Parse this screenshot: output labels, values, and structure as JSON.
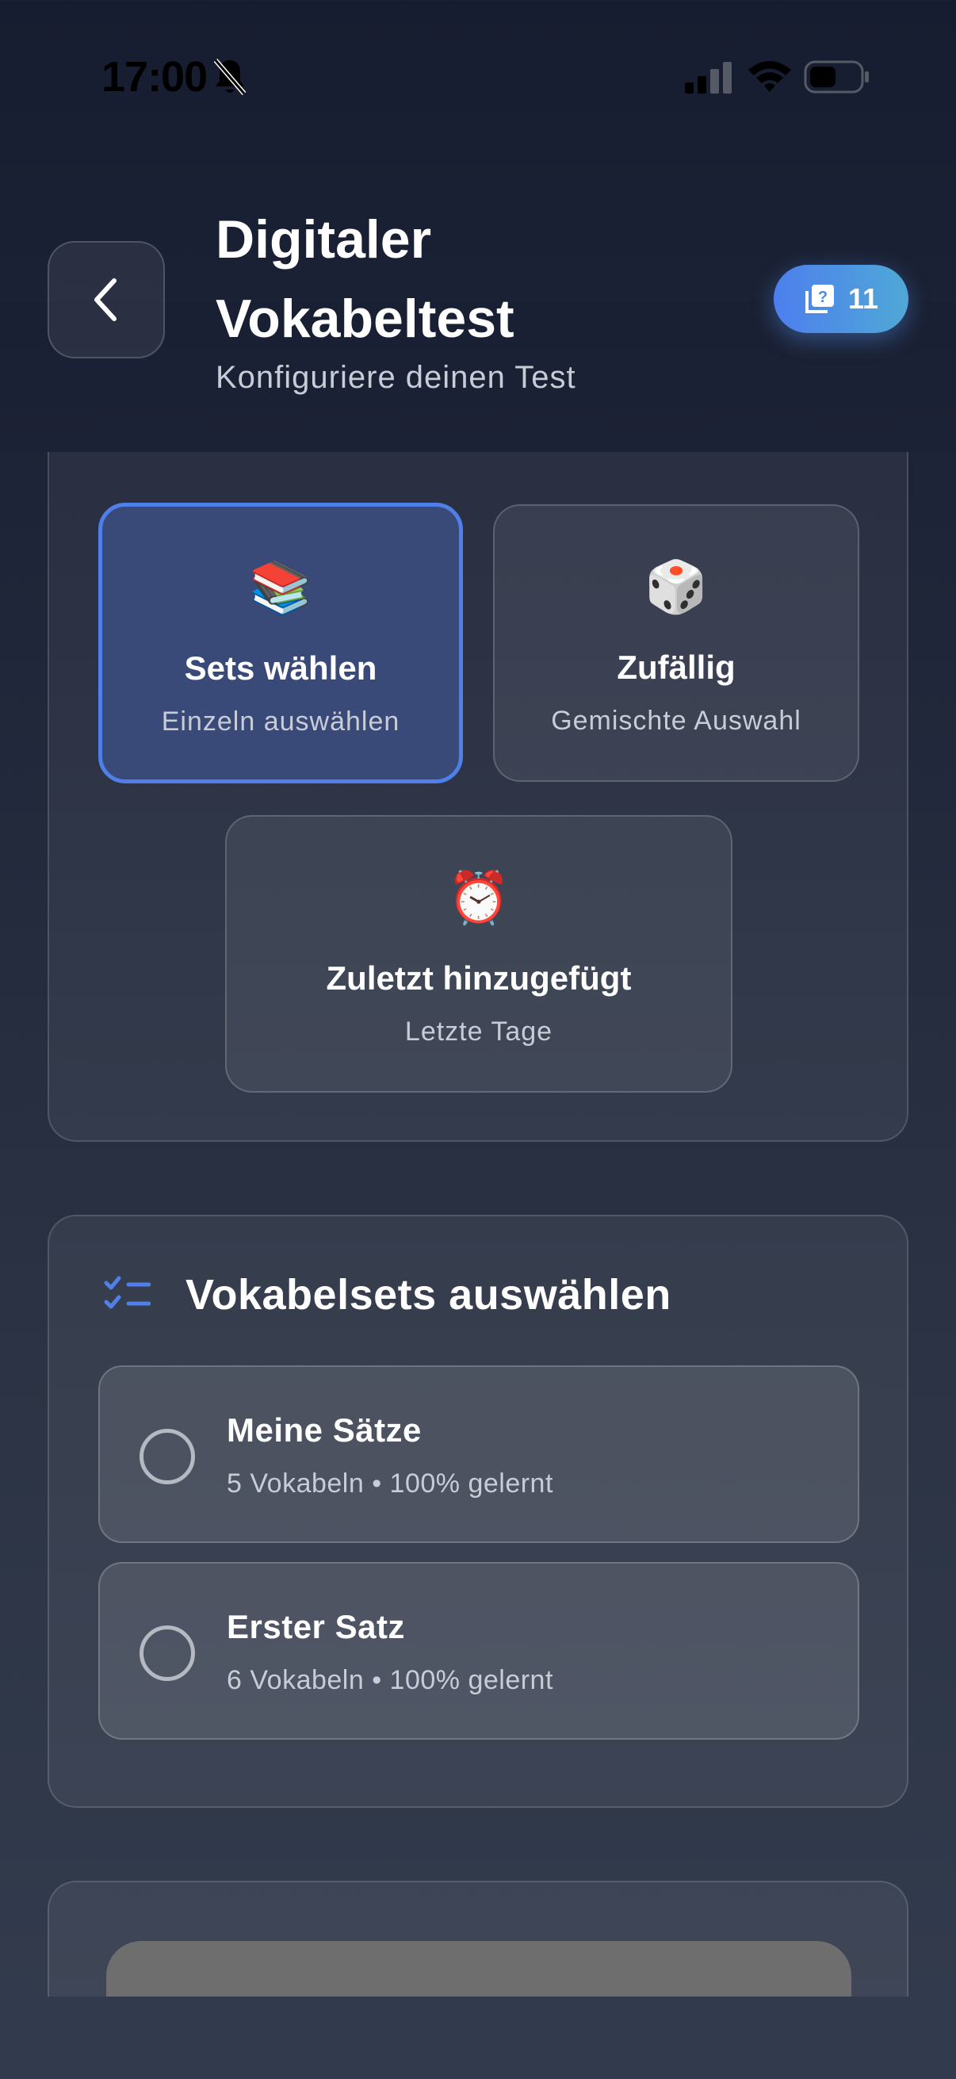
{
  "status_bar": {
    "time": "17:00"
  },
  "header": {
    "title": "Digitaler Vokabeltest",
    "subtitle": "Konfiguriere deinen Test",
    "badge_count": "11"
  },
  "modes": [
    {
      "emoji": "📚",
      "label": "Sets wählen",
      "description": "Einzeln auswählen",
      "selected": true
    },
    {
      "emoji": "🎲",
      "label": "Zufällig",
      "description": "Gemischte Auswahl",
      "selected": false
    },
    {
      "emoji": "⏰",
      "label": "Zuletzt hinzugefügt",
      "description": "Letzte Tage",
      "selected": false
    }
  ],
  "sets_section": {
    "title": "Vokabelsets auswählen",
    "items": [
      {
        "name": "Meine Sätze",
        "meta": "5 Vokabeln • 100% gelernt"
      },
      {
        "name": "Erster Satz",
        "meta": "6 Vokabeln • 100% gelernt"
      }
    ]
  },
  "colors": {
    "accent": "#4f7fe8",
    "badge_start": "#4d7fee",
    "badge_end": "#4fa8d6",
    "selected_bg": "#3a4a78"
  }
}
